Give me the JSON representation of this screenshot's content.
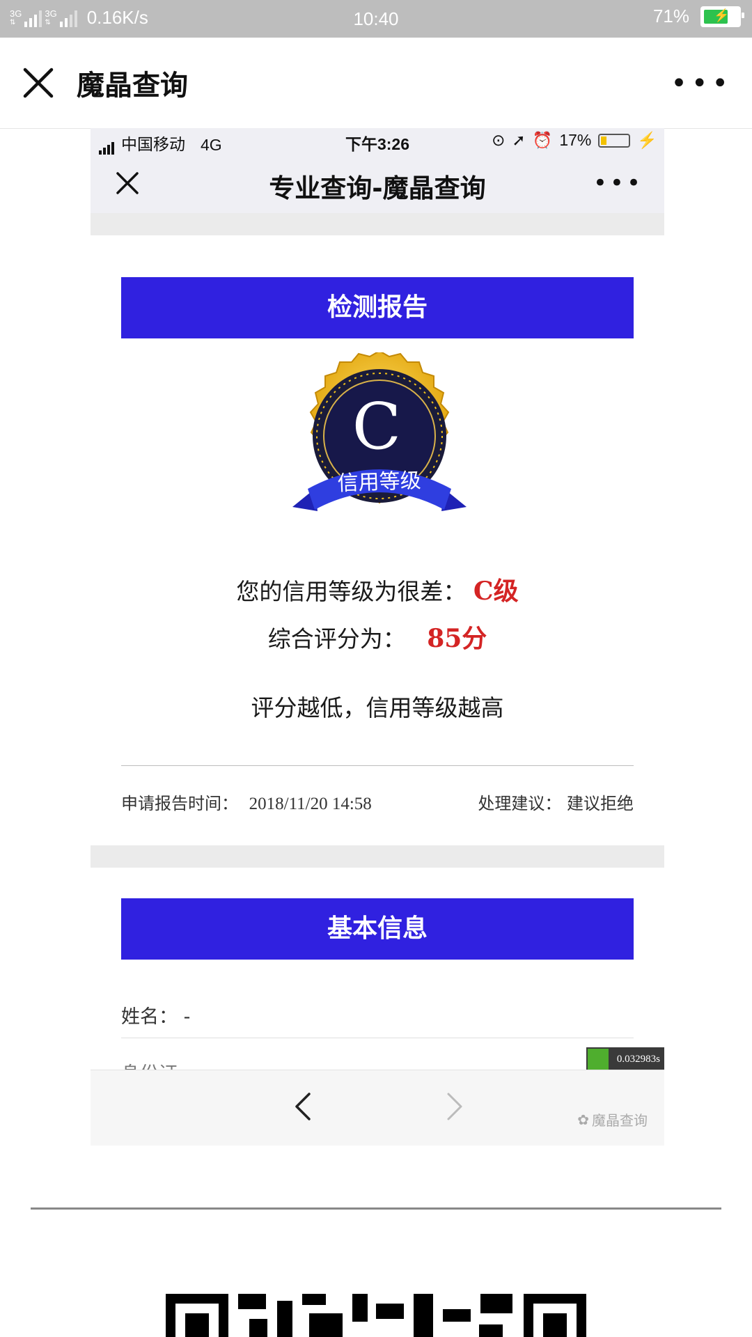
{
  "status_bar": {
    "network": "3G",
    "network2": "3G",
    "speed": "0.16K/s",
    "time": "10:40",
    "battery": "71%"
  },
  "outer_nav": {
    "title": "魔晶查询",
    "more": "•••"
  },
  "inner_status": {
    "carrier": "中国移动",
    "network": "4G",
    "time": "下午3:26",
    "battery": "17%"
  },
  "inner_nav": {
    "title": "专业查询-魔晶查询",
    "more": "•••"
  },
  "report": {
    "header": "检测报告",
    "badge_letter": "C",
    "badge_ribbon": "信用等级",
    "level_label": "您的信用等级为很差：",
    "level_value": "C级",
    "score_label": "综合评分为：",
    "score_value": "85分",
    "note": "评分越低，信用等级越高",
    "time_label": "申请报告时间：",
    "time_value": "2018/11/20 14:58",
    "advice_label": "处理建议：",
    "advice_value": "建议拒绝"
  },
  "basic_info": {
    "header": "基本信息",
    "name_label": "姓名：",
    "name_value": "-",
    "next_label_partial": "身份证"
  },
  "timer": "0.032983s",
  "watermark": "魔晶查询",
  "colors": {
    "header_blue": "#3021e0",
    "highlight_red": "#d42424",
    "status_gray": "#bdbdbd",
    "badge_gold": "#f3c21a",
    "badge_navy": "#17184a"
  }
}
